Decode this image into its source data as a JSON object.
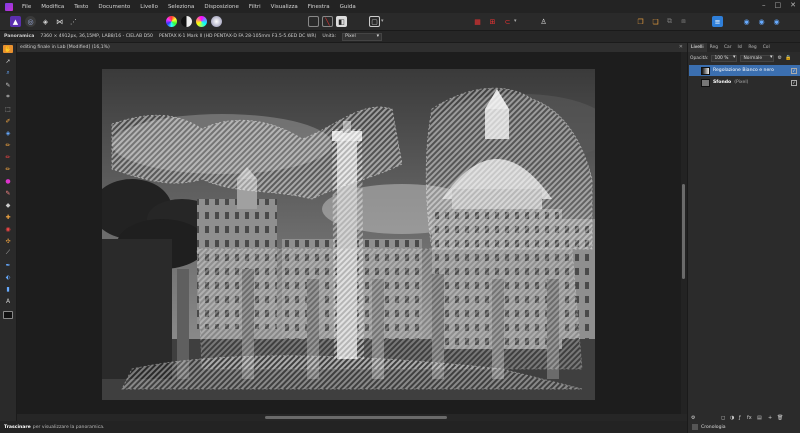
{
  "menu": [
    "File",
    "Modifica",
    "Testo",
    "Documento",
    "Livello",
    "Seleziona",
    "Disposizione",
    "Filtri",
    "Visualizza",
    "Finestra",
    "Guida"
  ],
  "window_controls": {
    "minimize": "–",
    "maximize": "□",
    "close": "✕"
  },
  "context": {
    "tool_name": "Panoramica",
    "image_info": "7360 × 4912px, 36,15MP, LAB8/16 - CIELAB D50",
    "camera_info": "PENTAX K-1 Mark II (HD PENTAX-D FA 28-105mm F3.5-5.6ED DC WR)",
    "unit_label": "Unità:",
    "unit_value": "Pixel"
  },
  "document_tab": {
    "title": "editing finale in Lab [Modified] (16,1%)",
    "close": "✕"
  },
  "panel": {
    "tabs": [
      "Livelli",
      "Reg",
      "Car",
      "Isl",
      "Reg",
      "Col"
    ],
    "opacity_label": "Opacità:",
    "opacity_value": "100 %",
    "blend_value": "Normale",
    "layers": [
      {
        "name": "Regolazione Bianco e nero",
        "selected": true
      },
      {
        "name": "Sfondo",
        "suffix": "(Pixel)",
        "selected": false
      }
    ],
    "history_label": "Cronologia"
  },
  "status": {
    "bold": "Trascinare",
    "text": "per visualizzare la panoramica."
  },
  "colors": {
    "accent": "#3b6fb0",
    "background": "#1d1d1d"
  }
}
